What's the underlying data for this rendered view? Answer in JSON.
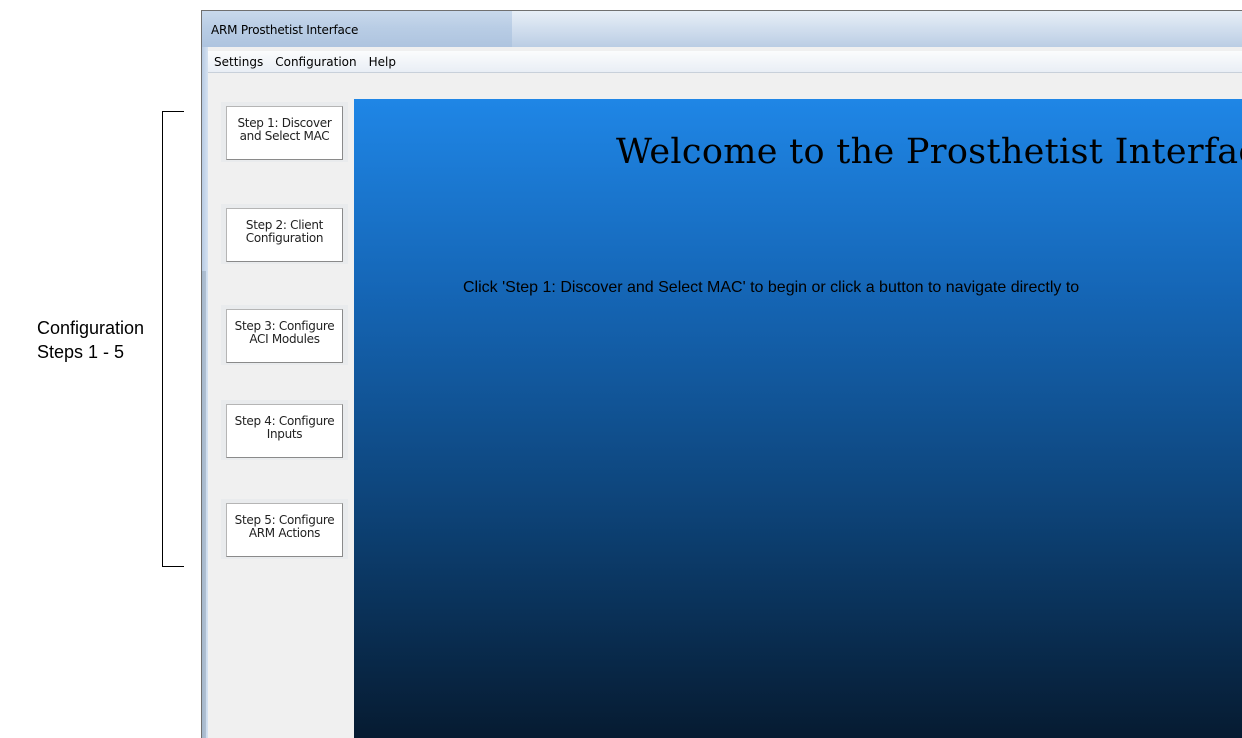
{
  "annotation": {
    "line1": "Configuration",
    "line2": "Steps 1 - 5"
  },
  "window": {
    "title": "ARM Prosthetist Interface"
  },
  "menu": {
    "items": [
      "Settings",
      "Configuration",
      "Help"
    ]
  },
  "sidebar": {
    "steps": [
      {
        "label": "Step 1: Discover\nand Select MAC"
      },
      {
        "label": "Step 2: Client\nConfiguration"
      },
      {
        "label": "Step 3: Configure\nACI Modules"
      },
      {
        "label": "Step 4: Configure\nInputs"
      },
      {
        "label": "Step 5: Configure\nARM Actions"
      }
    ]
  },
  "main": {
    "heading": "Welcome to the Prosthetist Interfac",
    "instruction": "Click 'Step 1: Discover and Select MAC' to begin or click a button to navigate directly to"
  },
  "colors": {
    "content_top": "#1f86e6",
    "content_bottom": "#061b31"
  }
}
